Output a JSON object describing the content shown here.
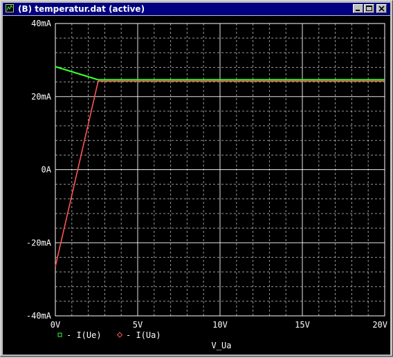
{
  "window": {
    "title": "(B) temperatur.dat (active)",
    "icons": [
      "app-icon",
      "minimize-icon",
      "maximize-icon",
      "close-icon"
    ]
  },
  "colors": {
    "titlebar": "#000080",
    "background": "#000000",
    "grid": "#ffffff",
    "series_ie": "#33ff33",
    "series_ia": "#ff5555"
  },
  "chart_data": {
    "type": "line",
    "xlabel": "V_Ua",
    "ylabel": "",
    "xlim": [
      0,
      20
    ],
    "ylim": [
      -40,
      40
    ],
    "x_ticks": [
      "0V",
      "5V",
      "10V",
      "15V",
      "20V"
    ],
    "y_ticks": [
      "40mA",
      "20mA",
      "0A",
      "-20mA",
      "-40mA"
    ],
    "grid": true,
    "legend_position": "bottom-left",
    "series": [
      {
        "name": "I(Ue)",
        "marker": "square",
        "color": "#33ff33",
        "x": [
          0,
          2.6,
          20
        ],
        "y": [
          28.2,
          24.6,
          24.6
        ]
      },
      {
        "name": "I(Ua)",
        "marker": "diamond",
        "color": "#ff5555",
        "x": [
          0,
          2.6,
          20
        ],
        "y": [
          -26.5,
          24.2,
          24.2
        ]
      }
    ]
  }
}
